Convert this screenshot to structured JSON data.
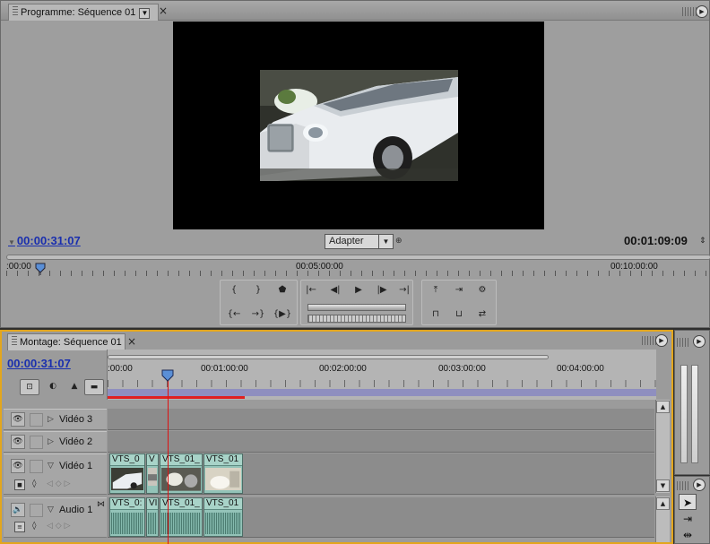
{
  "program": {
    "tab_label": "Programme: Séquence 01",
    "tab_menu_glyph": "▼",
    "close_glyph": "×",
    "options_glyph": "▶",
    "current_timecode": "00:00:31:07",
    "duration_timecode": "00:01:09:09",
    "fit_label": "Adapter",
    "ruler_labels": [
      ":00:00",
      "00:05:00:00",
      "00:10:00:00"
    ],
    "transport": {
      "mark_in": "{",
      "mark_out": "}",
      "set_marker": "⬟",
      "goto_in": "|←",
      "step_back": "◀|",
      "play": "▶",
      "step_forward": "|▶",
      "goto_out": "→|",
      "play_in_out": "{▶}",
      "lift": "⤒",
      "extract": "⇥",
      "output": "⚙",
      "trim_in": "{←",
      "trim_out": "→}",
      "insert": "⊓",
      "overlay": "⊔",
      "toggle": "⇄"
    }
  },
  "sequence": {
    "tab_label": "Montage: Séquence 01",
    "close_glyph": "×",
    "options_glyph": "▶",
    "current_timecode": "00:00:31:07",
    "ruler_labels": [
      ":00:00",
      "00:01:00:00",
      "00:02:00:00",
      "00:03:00:00",
      "00:04:00:00"
    ],
    "tools": [
      "⊡",
      "◐",
      "▲",
      "▬"
    ],
    "tracks": [
      {
        "name": "Vidéo 3",
        "type": "video",
        "expanded": false
      },
      {
        "name": "Vidéo 2",
        "type": "video",
        "expanded": false
      },
      {
        "name": "Vidéo 1",
        "type": "video",
        "expanded": true,
        "clips": [
          "VTS_0",
          "V",
          "VTS_01_",
          "VTS_01"
        ]
      },
      {
        "name": "Audio 1",
        "type": "audio",
        "expanded": true,
        "clips": [
          "VTS_0:",
          "VI",
          "VTS_01_",
          "VTS_01"
        ]
      }
    ],
    "playhead_timecode": "00:00:31:07"
  },
  "colors": {
    "accent_active": "#e3a61d",
    "timecode_blue": "#1a2fae",
    "clip_fill": "#93c3b8",
    "playhead": "#dd1111"
  },
  "icons": {
    "eye": "eye-icon",
    "selection": "selection-arrow-icon",
    "track_select": "track-select-icon",
    "ripple": "ripple-edit-icon"
  },
  "tools_panel": {
    "selection": "➤",
    "track_select": "⇥",
    "ripple": "⇹",
    "rolling": "⇔"
  }
}
